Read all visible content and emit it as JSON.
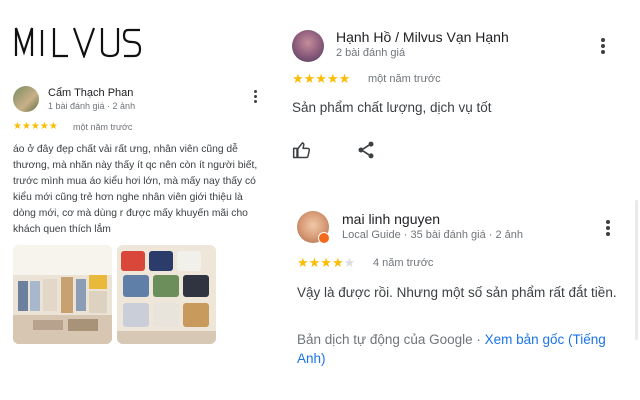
{
  "brand": {
    "logo_text": "MILVUS"
  },
  "review_left": {
    "name": "Cẩm Thạch Phan",
    "meta": "1 bài đánh giá · 2 ảnh",
    "stars": "★★★★★",
    "rating": 5,
    "time": "một năm trước",
    "text": "áo ở đây đẹp chất vải rất ưng, nhân viên cũng dễ thương, mà nhãn này thấy ít qc nên còn ít người biết, trước mình mua áo kiểu hơi lớn, mà mấy nay thấy có kiểu mới cũng trẻ hơn nghe nhân viên giới thiệu là dòng mới, cơ mà dùng r được mấy khuyến mãi cho khách quen thích lắm",
    "photo_count": 2
  },
  "review_right_1": {
    "name": "Hạnh Hồ / Milvus Vạn Hạnh",
    "meta": "2 bài đánh giá",
    "stars": "★★★★★",
    "rating": 5,
    "time": "một năm trước",
    "text": "Sản phẩm chất lượng, dịch vụ tốt"
  },
  "review_right_2": {
    "name": "mai linh nguyen",
    "meta": "Local Guide · 35 bài đánh giá · 2 ảnh",
    "stars_on": "★★★★",
    "stars_off": "★",
    "rating": 4,
    "time": "4 năm trước",
    "text": "Vậy là được rồi. Nhưng một số sản phẩm rất đắt tiền.",
    "translate_prefix": "Bản dịch tự động của Google · ",
    "translate_link": "Xem bản gốc (Tiếng Anh)"
  },
  "icons": {
    "like": "thumbs-up-icon",
    "share": "share-icon",
    "more": "more-vert-icon",
    "local_guide": "local-guide-badge-icon"
  },
  "colors": {
    "star": "#fbbc04",
    "star_empty": "#dadce0",
    "link": "#1a73e8",
    "secondary_text": "#70757a",
    "badge": "#f26b1d"
  }
}
